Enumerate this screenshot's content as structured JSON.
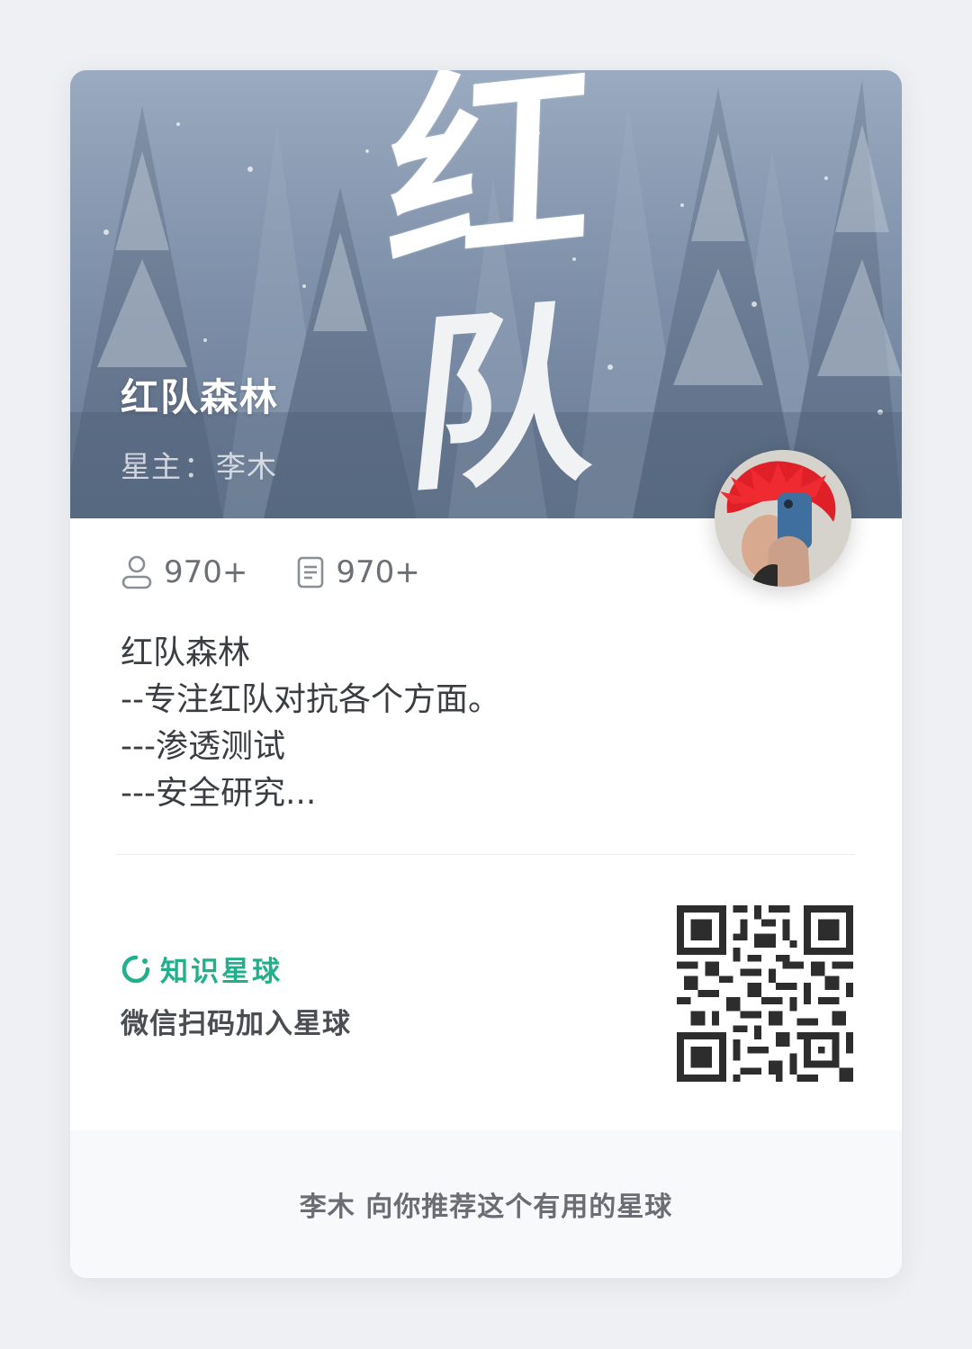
{
  "cover": {
    "title": "红队森林",
    "owner_label": "星主",
    "owner_sep": "：",
    "owner_name": "李木",
    "calligraphy": [
      "红",
      "队"
    ]
  },
  "stats": {
    "members": {
      "icon": "user-icon",
      "value": "970+"
    },
    "posts": {
      "icon": "document-icon",
      "value": "970+"
    }
  },
  "description": {
    "lines": [
      "红队森林",
      "--专注红队对抗各个方面。",
      "---渗透测试",
      "---安全研究..."
    ]
  },
  "brand": {
    "icon": "planet-logo-icon",
    "name": "知识星球",
    "color": "#21b08b"
  },
  "join": {
    "scan_text": "微信扫码加入星球",
    "qr_icon": "qr-code-icon"
  },
  "footer": {
    "text": "李木 向你推荐这个有用的星球"
  }
}
